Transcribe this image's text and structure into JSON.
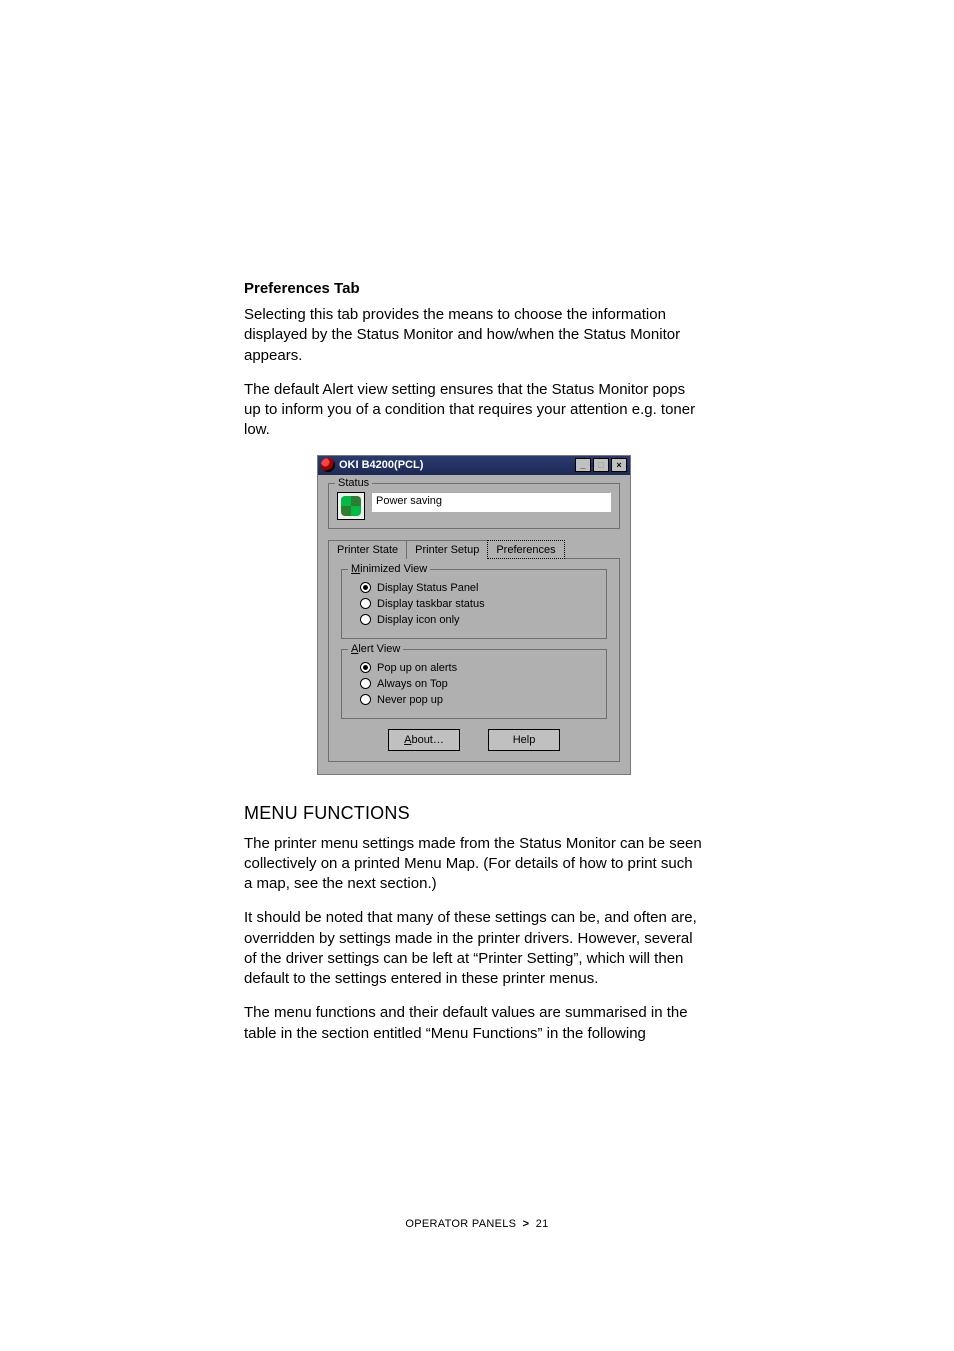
{
  "section": {
    "title": "Preferences Tab",
    "para1": "Selecting this tab provides the means to choose the information displayed by the Status Monitor and how/when the Status Monitor appears.",
    "para2": "The default Alert view setting ensures that the Status Monitor pops up to inform you of a condition that requires your attention e.g. toner low."
  },
  "dialog": {
    "title": "OKI B4200(PCL)",
    "status_legend": "Status",
    "status_value": "Power saving",
    "tabs": {
      "state": "Printer State",
      "setup": "Printer Setup",
      "prefs": "Preferences"
    },
    "min_view": {
      "legend_pre": "M",
      "legend_rest": "inimized View",
      "opt1": "Display Status Panel",
      "opt2": "Display taskbar status",
      "opt3": "Display icon only"
    },
    "alert_view": {
      "legend_pre": "A",
      "legend_rest": "lert View",
      "opt1": "Pop up on alerts",
      "opt2": "Always on Top",
      "opt3": "Never pop up"
    },
    "buttons": {
      "about_pre": "A",
      "about_rest": "bout…",
      "help": "Help"
    },
    "win_btns": {
      "min": "_",
      "max": "□",
      "close": "×"
    }
  },
  "menu": {
    "title": "MENU FUNCTIONS",
    "para1": "The printer menu settings made from the Status Monitor can be seen collectively on a printed Menu Map. (For details of how to print such a map, see the next section.)",
    "para2": "It should be noted that many of these settings can be, and often are, overridden by settings made in the printer drivers. However, several of the driver settings can be left at “Printer Setting”, which will then default to the settings entered in these printer menus.",
    "para3": "The menu functions and their default values are summarised in the table in the section entitled “Menu Functions” in the following"
  },
  "footer": {
    "left": "OPERATOR PANELS",
    "sep": ">",
    "page": "21"
  }
}
